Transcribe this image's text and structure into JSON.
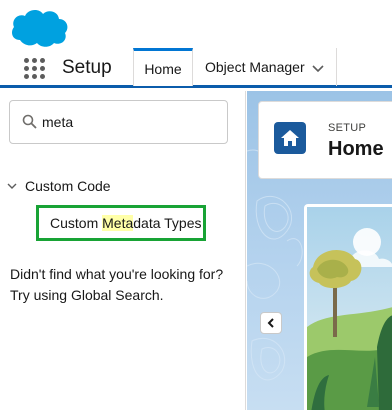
{
  "app": {
    "logo": "salesforce-cloud-logo",
    "name": "Setup",
    "brand_color": "#00a1e0"
  },
  "tabs": [
    {
      "label": "Home",
      "active": true
    },
    {
      "label": "Object Manager",
      "active": false
    }
  ],
  "sidebar": {
    "search": {
      "value": "meta",
      "placeholder": ""
    },
    "group": {
      "label": "Custom Code",
      "expanded": true
    },
    "result": {
      "before": "Custom ",
      "highlight": "Meta",
      "after": "data Types"
    },
    "not_found_line1": "Didn't find what you're looking for?",
    "not_found_line2": "Try using Global Search."
  },
  "main": {
    "header": {
      "eyebrow": "SETUP",
      "title": "Home",
      "icon": "home-icon"
    },
    "carousel_prev_icon": "chevron-left-icon"
  },
  "colors": {
    "accent": "#0176d3",
    "highlight_box": "#18a335",
    "search_highlight": "#ffffa8",
    "home_tile": "#1b5a9c"
  }
}
